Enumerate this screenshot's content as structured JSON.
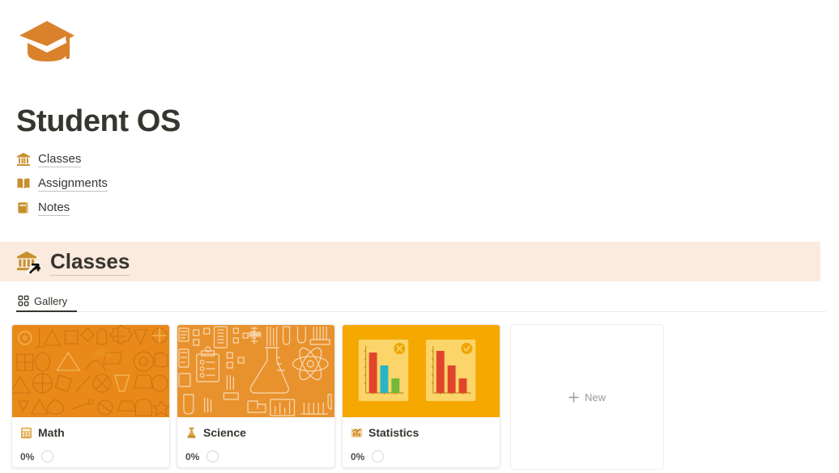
{
  "brand": {
    "logo_icon": "graduation-cap-icon",
    "logo_color": "#d9822b"
  },
  "header": {
    "title": "Student OS"
  },
  "nav": {
    "items": [
      {
        "label": "Classes",
        "icon": "bank-building-icon"
      },
      {
        "label": "Assignments",
        "icon": "open-book-icon"
      },
      {
        "label": "Notes",
        "icon": "notebook-icon"
      }
    ]
  },
  "section": {
    "title": "Classes",
    "icon": "bank-building-link-icon",
    "band_color": "#fbeade"
  },
  "view": {
    "tabs": [
      {
        "label": "Gallery",
        "icon": "grid-icon",
        "active": true
      }
    ]
  },
  "gallery": {
    "cards": [
      {
        "title": "Math",
        "icon": "calculator-icon",
        "progress_label": "0%",
        "progress_value": 0,
        "cover": "math-shapes-pattern",
        "cover_color": "#e8891a"
      },
      {
        "title": "Science",
        "icon": "flask-icon",
        "progress_label": "0%",
        "progress_value": 0,
        "cover": "science-lab-pattern",
        "cover_color": "#e8922e"
      },
      {
        "title": "Statistics",
        "icon": "bar-chart-icon",
        "progress_label": "0%",
        "progress_value": 0,
        "cover": "bar-charts-illustration",
        "cover_color": "#f5a800"
      }
    ],
    "new_card": {
      "label": "New",
      "icon": "plus-icon"
    }
  },
  "chart_data": [
    {
      "type": "bar",
      "title": "Statistics cover — chart A (marked incorrect)",
      "categories": [
        "1",
        "2",
        "3"
      ],
      "values": [
        85,
        55,
        28
      ],
      "colors": [
        "#e0452c",
        "#29b6c4",
        "#74b93a"
      ],
      "badge": "x-mark",
      "grid": false,
      "ylim": [
        0,
        100
      ]
    },
    {
      "type": "bar",
      "title": "Statistics cover — chart B (marked correct)",
      "categories": [
        "1",
        "2",
        "3"
      ],
      "values": [
        88,
        55,
        30
      ],
      "colors": [
        "#e0452c",
        "#e0452c",
        "#e0452c"
      ],
      "badge": "check-mark",
      "grid": false,
      "ylim": [
        0,
        100
      ]
    }
  ]
}
